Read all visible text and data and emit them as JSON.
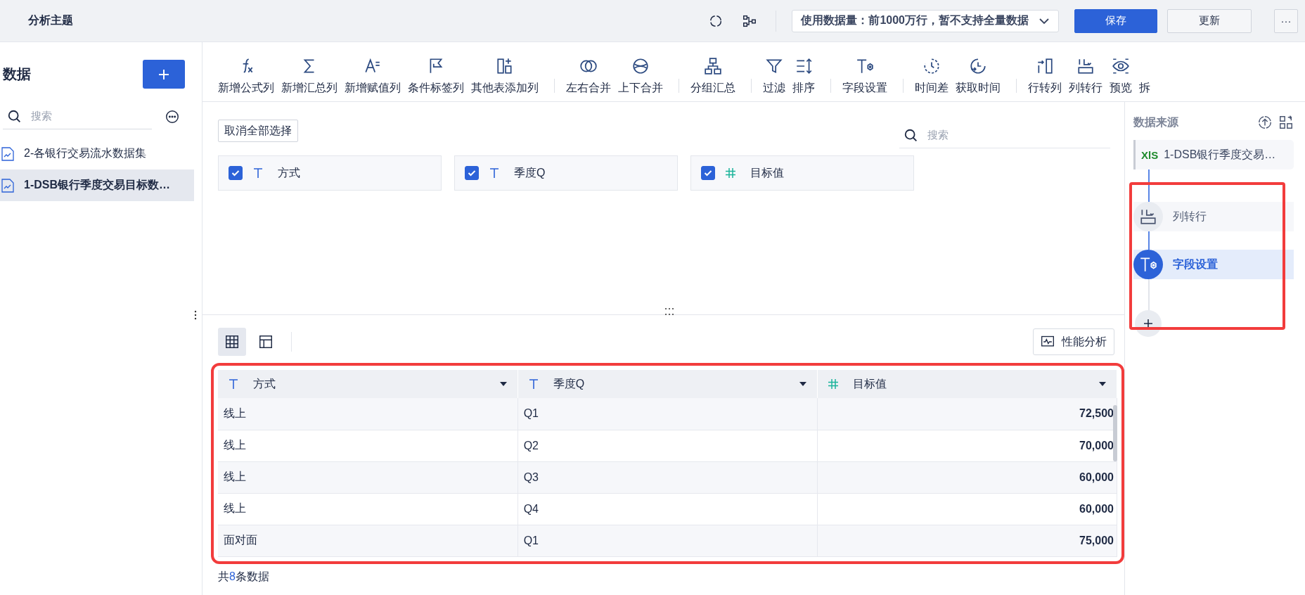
{
  "header": {
    "title": "分析主题",
    "data_limit": "使用数据量：前1000万行，暂不支持全量数据",
    "buttons": [
      {
        "label": "保存",
        "kind": "primary"
      },
      {
        "label": "更新",
        "kind": "default"
      },
      {
        "label": "···",
        "kind": "more"
      }
    ]
  },
  "sidebar": {
    "title": "数据",
    "search": {
      "placeholder": "搜索"
    },
    "items": [
      {
        "label": "2-各银行交易流水数据集",
        "selected": false
      },
      {
        "label": "1-DSB银行季度交易目标数…",
        "selected": true
      }
    ]
  },
  "toolbar": [
    {
      "items": [
        {
          "label": "新增公式列",
          "kind": "formula"
        },
        {
          "label": "新增汇总列",
          "kind": "sum"
        },
        {
          "label": "新增赋值列",
          "kind": "assign"
        },
        {
          "label": "条件标签列",
          "kind": "flag"
        },
        {
          "label": "其他表添加列",
          "kind": "addcol"
        }
      ]
    },
    {
      "items": [
        {
          "label": "左右合并",
          "kind": "mergelr"
        },
        {
          "label": "上下合并",
          "kind": "mergetb"
        }
      ]
    },
    {
      "items": [
        {
          "label": "分组汇总",
          "kind": "group"
        }
      ]
    },
    {
      "items": [
        {
          "label": "过滤",
          "kind": "filter"
        },
        {
          "label": "排序",
          "kind": "sort"
        }
      ]
    },
    {
      "items": [
        {
          "label": "字段设置",
          "kind": "field"
        }
      ]
    },
    {
      "items": [
        {
          "label": "时间差",
          "kind": "timediff"
        },
        {
          "label": "获取时间",
          "kind": "gettime"
        }
      ]
    },
    {
      "items": [
        {
          "label": "行转列",
          "kind": "row2col"
        },
        {
          "label": "列转行",
          "kind": "col2row"
        },
        {
          "label": "预览",
          "kind": "preview"
        },
        {
          "label": "拆",
          "kind": "none"
        }
      ]
    }
  ],
  "fields": {
    "deselect_all": "取消全部选择",
    "search": {
      "placeholder": "搜索"
    },
    "items": [
      {
        "name": "方式",
        "kind": "text",
        "checked": true
      },
      {
        "name": "季度Q",
        "kind": "text",
        "checked": true
      },
      {
        "name": "目标值",
        "kind": "number",
        "checked": true
      }
    ]
  },
  "preview": {
    "views": [
      {
        "kind": "grid",
        "selected": true
      },
      {
        "kind": "layout",
        "selected": false
      }
    ],
    "analysis_button": "性能分析",
    "table": {
      "columns": [
        {
          "name": "方式",
          "kind": "text"
        },
        {
          "name": "季度Q",
          "kind": "text"
        },
        {
          "name": "目标值",
          "kind": "number"
        }
      ],
      "rows": [
        [
          "线上",
          "Q1",
          "72,500"
        ],
        [
          "线上",
          "Q2",
          "70,000"
        ],
        [
          "线上",
          "Q3",
          "60,000"
        ],
        [
          "线上",
          "Q4",
          "60,000"
        ],
        [
          "面对面",
          "Q1",
          "75,000"
        ]
      ]
    },
    "footer": {
      "prefix": "共",
      "count": "8",
      "suffix": "条数据"
    }
  },
  "flow": {
    "title": "数据来源",
    "source": {
      "badge": "XlS",
      "name": "1-DSB银行季度交易…"
    },
    "steps": [
      {
        "label": "列转行",
        "kind": "col2row",
        "selected": false
      },
      {
        "label": "字段设置",
        "kind": "field",
        "selected": true
      }
    ]
  }
}
